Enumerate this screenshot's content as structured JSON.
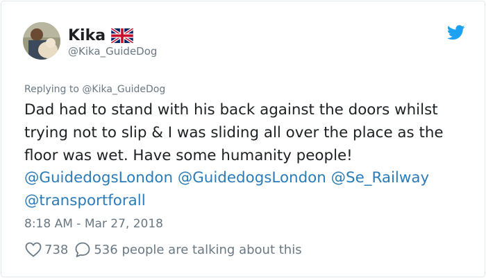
{
  "tweet": {
    "author_name": "Kika",
    "author_handle": "@Kika_GuideDog",
    "replying_prefix": "Replying to",
    "replying_to": "@Kika_GuideDog",
    "text_segments": [
      {
        "type": "text",
        "value": "Dad had to stand with his back against the doors whilst trying not to slip & I was sliding all over the place as the floor was wet. Have some humanity people! "
      },
      {
        "type": "link",
        "value": "@GuidedogsLondon"
      },
      {
        "type": "text",
        "value": " "
      },
      {
        "type": "link",
        "value": "@GuidedogsLondon"
      },
      {
        "type": "text",
        "value": " "
      },
      {
        "type": "link",
        "value": "@Se_Railway"
      },
      {
        "type": "text",
        "value": " "
      },
      {
        "type": "link",
        "value": "@transportforall"
      }
    ],
    "timestamp": "8:18 AM - Mar 27, 2018",
    "likes": "738",
    "talking": "536 people are talking about this"
  },
  "icons": {
    "flag": "uk-flag-icon",
    "brand": "twitter-bird-icon",
    "like": "heart-icon",
    "reply": "speech-bubble-icon"
  },
  "colors": {
    "text": "#1c2022",
    "muted": "#697882",
    "link": "#2b7bb9",
    "twitter_blue": "#1da1f2",
    "border": "#e1e8ed"
  }
}
